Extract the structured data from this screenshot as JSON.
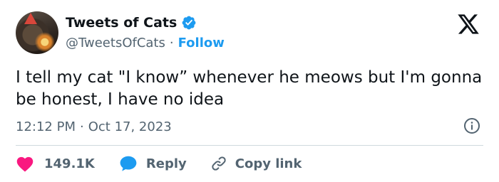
{
  "author": {
    "display_name": "Tweets of Cats",
    "handle": "@TweetsOfCats",
    "separator": "·",
    "follow_label": "Follow",
    "verified": true
  },
  "tweet": {
    "text": "I tell my cat \"I know” whenever he meows but I'm gonna be honest, I have no idea",
    "time": "12:12 PM",
    "date_separator": "·",
    "date": "Oct 17, 2023"
  },
  "actions": {
    "likes_count": "149.1K",
    "reply_label": "Reply",
    "copy_link_label": "Copy link"
  },
  "icons": {
    "verified": "verified-badge-icon",
    "platform": "x-logo-icon",
    "info": "info-icon",
    "like": "heart-icon",
    "reply": "speech-bubble-icon",
    "copy": "link-icon"
  },
  "colors": {
    "text": "#0f1419",
    "secondary": "#536471",
    "accent": "#1d9bf0",
    "like": "#f91880",
    "divider": "#cfd9de"
  }
}
